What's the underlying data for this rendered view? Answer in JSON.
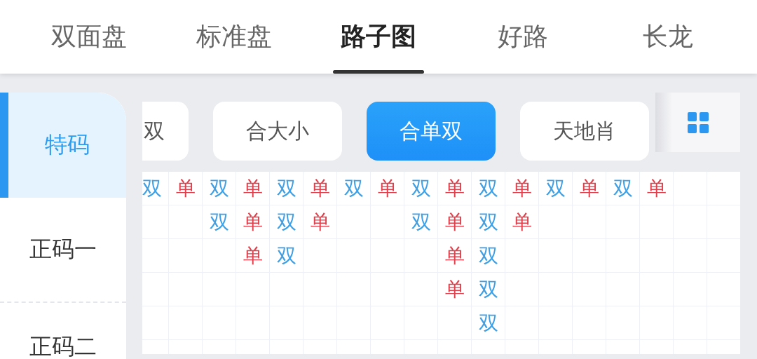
{
  "tabs": [
    {
      "label": "双面盘",
      "selected": false
    },
    {
      "label": "标准盘",
      "selected": false
    },
    {
      "label": "路子图",
      "selected": true
    },
    {
      "label": "好路",
      "selected": false
    },
    {
      "label": "长龙",
      "selected": false
    }
  ],
  "sidebar": {
    "items": [
      {
        "label": "特码",
        "selected": true
      },
      {
        "label": "正码一",
        "selected": false
      },
      {
        "label": "正码二",
        "selected": false
      }
    ]
  },
  "filters": [
    {
      "label": "双",
      "selected": false
    },
    {
      "label": "合大小",
      "selected": false
    },
    {
      "label": "合单双",
      "selected": true
    },
    {
      "label": "天地肖",
      "selected": false
    }
  ],
  "road_map": {
    "columns": [
      [
        {
          "text": "双",
          "color": "#3d9fe6"
        }
      ],
      [
        {
          "text": "单",
          "color": "#e0404c"
        }
      ],
      [
        {
          "text": "双",
          "color": "#3d9fe6"
        },
        {
          "text": "双",
          "color": "#3d9fe6"
        }
      ],
      [
        {
          "text": "单",
          "color": "#e0404c"
        },
        {
          "text": "单",
          "color": "#e0404c"
        },
        {
          "text": "单",
          "color": "#e0404c"
        }
      ],
      [
        {
          "text": "双",
          "color": "#3d9fe6"
        },
        {
          "text": "双",
          "color": "#3d9fe6"
        },
        {
          "text": "双",
          "color": "#3d9fe6"
        }
      ],
      [
        {
          "text": "单",
          "color": "#e0404c"
        },
        {
          "text": "单",
          "color": "#e0404c"
        }
      ],
      [
        {
          "text": "双",
          "color": "#3d9fe6"
        }
      ],
      [
        {
          "text": "单",
          "color": "#e0404c"
        }
      ],
      [
        {
          "text": "双",
          "color": "#3d9fe6"
        },
        {
          "text": "双",
          "color": "#3d9fe6"
        }
      ],
      [
        {
          "text": "单",
          "color": "#e0404c"
        },
        {
          "text": "单",
          "color": "#e0404c"
        },
        {
          "text": "单",
          "color": "#e0404c"
        },
        {
          "text": "单",
          "color": "#e0404c"
        }
      ],
      [
        {
          "text": "双",
          "color": "#3d9fe6"
        },
        {
          "text": "双",
          "color": "#3d9fe6"
        },
        {
          "text": "双",
          "color": "#3d9fe6"
        },
        {
          "text": "双",
          "color": "#3d9fe6"
        },
        {
          "text": "双",
          "color": "#3d9fe6"
        }
      ],
      [
        {
          "text": "单",
          "color": "#e0404c"
        },
        {
          "text": "单",
          "color": "#e0404c"
        }
      ],
      [
        {
          "text": "双",
          "color": "#3d9fe6"
        }
      ],
      [
        {
          "text": "单",
          "color": "#e0404c"
        }
      ],
      [
        {
          "text": "双",
          "color": "#3d9fe6"
        }
      ],
      [
        {
          "text": "单",
          "color": "#e0404c"
        }
      ]
    ]
  }
}
